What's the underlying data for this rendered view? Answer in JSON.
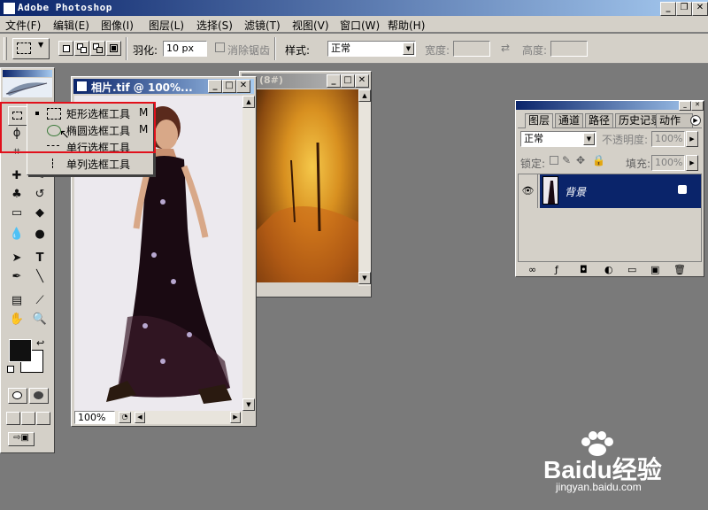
{
  "window": {
    "title": "Adobe Photoshop"
  },
  "menu": [
    "文件(F)",
    "编辑(E)",
    "图像(I)",
    "图层(L)",
    "选择(S)",
    "滤镜(T)",
    "视图(V)",
    "窗口(W)",
    "帮助(H)"
  ],
  "options": {
    "feather_label": "羽化:",
    "feather_value": "10 px",
    "antialias_label": "消除锯齿",
    "style_label": "样式:",
    "style_value": "正常",
    "width_label": "宽度:",
    "height_label": "高度:"
  },
  "flyout": {
    "items": [
      {
        "label": "矩形选框工具",
        "key": "M"
      },
      {
        "label": "椭圆选框工具",
        "key": "M"
      },
      {
        "label": "单行选框工具",
        "key": ""
      },
      {
        "label": "单列选框工具",
        "key": ""
      }
    ]
  },
  "doc1": {
    "title": "相片.tif @ 100%...",
    "zoom": "100%"
  },
  "doc2": {
    "title": "(8#)"
  },
  "layers_panel": {
    "tabs": [
      "图层",
      "通道",
      "路径",
      "历史记录",
      "动作"
    ],
    "blend_mode": "正常",
    "opacity_label": "不透明度:",
    "opacity_value": "100%",
    "lock_label": "锁定:",
    "fill_label": "填充:",
    "fill_value": "100%",
    "layer_name": "背景"
  },
  "watermark": {
    "brand": "Baidu经验",
    "url": "jingyan.baidu.com"
  },
  "colors": {
    "title_active": "#0a246a",
    "selection_box": "#e1101b",
    "layer_selected": "#0a246a"
  }
}
